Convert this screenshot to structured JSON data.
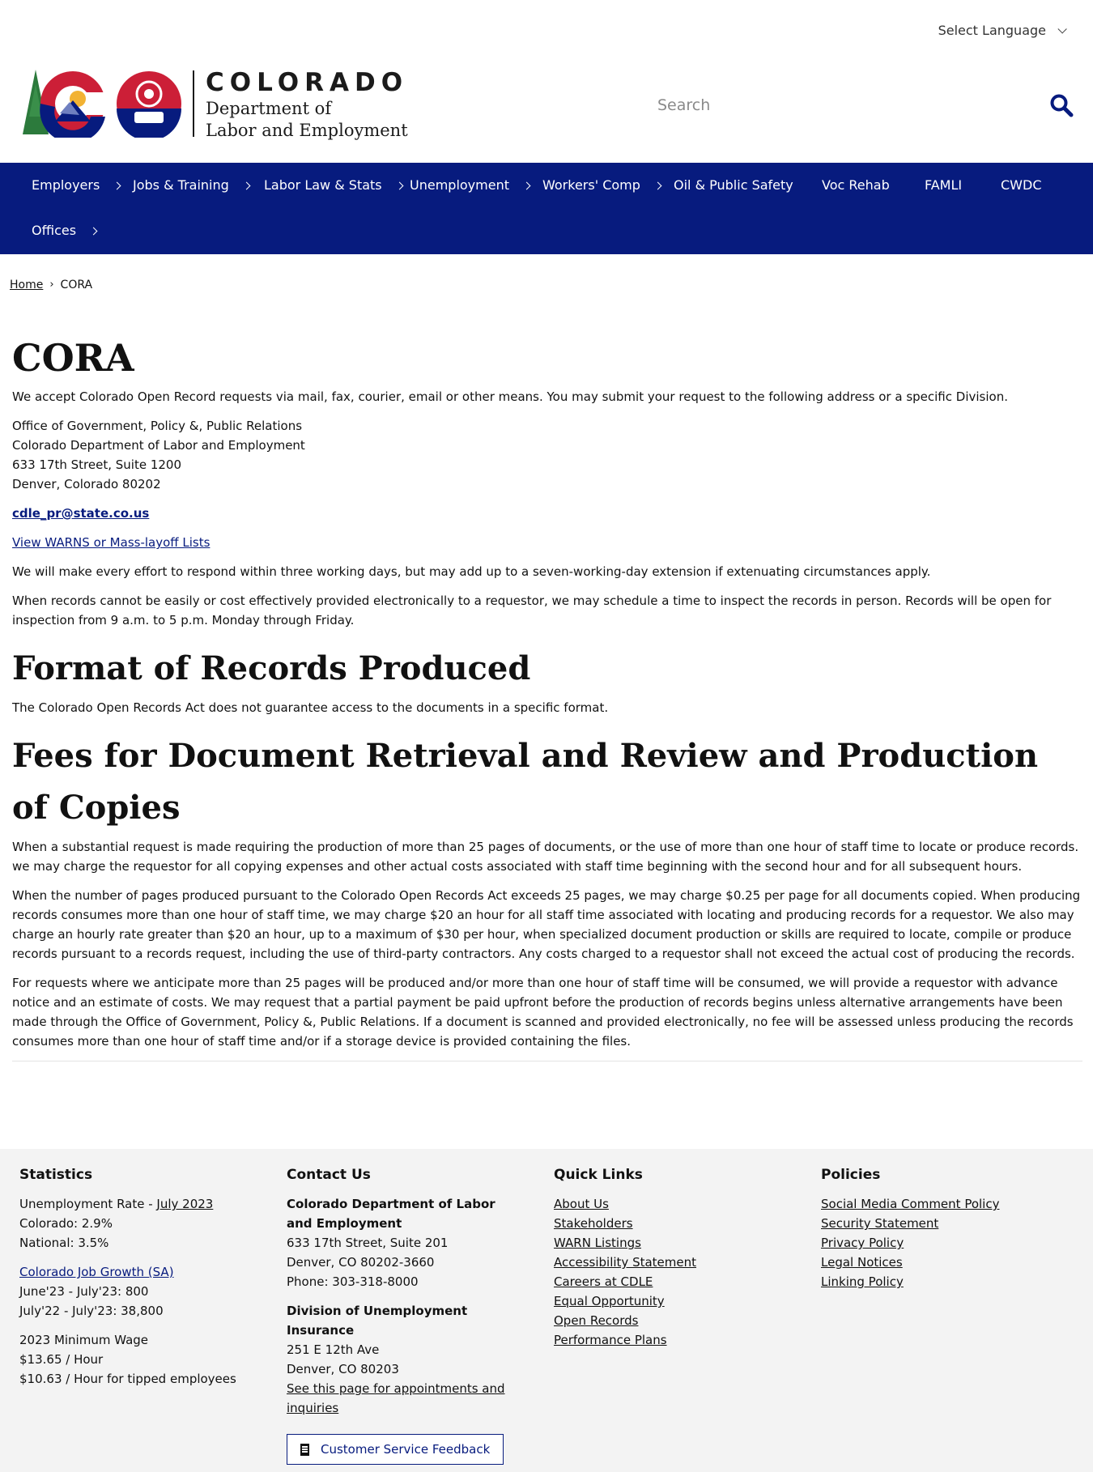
{
  "language": {
    "label": "Select Language"
  },
  "header": {
    "state": "COLORADO",
    "dept_line1": "Department of",
    "dept_line2": "Labor and Employment",
    "logo_badge": "CDLE",
    "search_placeholder": "Search"
  },
  "nav": {
    "items": [
      {
        "label": "Employers",
        "has_submenu": true
      },
      {
        "label": "Jobs & Training",
        "has_submenu": true
      },
      {
        "label": "Labor Law & Stats",
        "has_submenu": true
      },
      {
        "label": "Unemployment",
        "has_submenu": true
      },
      {
        "label": "Workers' Comp",
        "has_submenu": true
      },
      {
        "label": "Oil & Public Safety",
        "has_submenu": false
      },
      {
        "label": "Voc Rehab",
        "has_submenu": false
      },
      {
        "label": "FAMLI",
        "has_submenu": false
      },
      {
        "label": "CWDC",
        "has_submenu": false
      },
      {
        "label": "Offices",
        "has_submenu": true
      }
    ]
  },
  "breadcrumb": {
    "home": "Home",
    "current": "CORA"
  },
  "main": {
    "title": "CORA",
    "intro": "We accept Colorado Open Record requests via mail, fax, courier, email or other means. You may submit your request to the following address or a specific Division.",
    "address": [
      "Office of Government, Policy &, Public Relations",
      "Colorado Department of Labor and Employment",
      "633 17th Street, Suite 1200",
      "Denver, Colorado 80202"
    ],
    "email": "cdle_pr@state.co.us",
    "warns_link": "View WARNS or Mass-layoff Lists",
    "response_text": "We will make every effort to respond within three working days, but may add up to a seven-working-day extension if extenuating circumstances apply.",
    "inspection_text": "When records cannot be easily or cost effectively provided electronically to a requestor, we may schedule a time to inspect the records in person. Records will be open for inspection from 9 a.m. to 5 p.m. Monday through Friday.",
    "format_heading": "Format of Records Produced",
    "format_text": "The Colorado Open Records Act does not guarantee access to the documents in a specific format.",
    "fees_heading": "Fees for Document Retrieval and Review and Production of Copies",
    "fees_p1": "When a substantial request is made requiring the production of more than 25 pages of documents, or the use of more than one hour of staff time to locate or produce records. we may charge the requestor for all copying expenses and other actual costs associated with staff time beginning with the second hour and for all subsequent hours.",
    "fees_p2": "When the number of pages produced pursuant to the Colorado Open Records Act exceeds 25 pages, we may charge $0.25 per page for all documents copied. When producing records consumes more than one hour of staff time, we may charge $20 an hour for all staff time associated with locating and producing records for a requestor. We also may charge an hourly rate greater than $20 an hour, up to a maximum of $30 per hour, when specialized document production or skills are required to locate, compile or produce records pursuant to a records request, including the use of third-party contractors. Any costs charged to a requestor shall not exceed the actual cost of producing the records.",
    "fees_p3": "For requests where we anticipate more than 25 pages will be produced and/or more than one hour of staff time will be consumed, we will provide a requestor with advance notice and an estimate of costs. We may request that a partial payment be paid upfront before the production of records begins unless alternative arrangements have been made through the Office of Government, Policy &, Public Relations. If a document is scanned and provided electronically, no fee will be assessed unless producing the records consumes more than one hour of staff time and/or if a storage device is provided containing the files."
  },
  "footer": {
    "statistics": {
      "heading": "Statistics",
      "unemp_prefix": "Unemployment Rate - ",
      "unemp_link": "July 2023",
      "colorado": "Colorado: 2.9%",
      "national": "National: 3.5%",
      "job_growth_link": "Colorado Job Growth (SA)",
      "june_july": "June'23 - July'23: 800",
      "july_july": "July'22 - July'23: 38,800",
      "min_wage_title": "2023 Minimum Wage",
      "min_wage": "$13.65 / Hour",
      "tipped_wage": "$10.63 / Hour for tipped employees"
    },
    "contact": {
      "heading": "Contact Us",
      "org_name": "Colorado Department of Labor and Employment",
      "org_street": "633 17th Street, Suite 201",
      "org_city": "Denver, CO  80202-3660",
      "org_phone": "Phone: 303-318-8000",
      "ui_name": "Division of Unemployment Insurance",
      "ui_street": "251 E 12th Ave",
      "ui_city": "Denver, CO  80203",
      "ui_link": "See this page for appointments and inquiries",
      "feedback": "Customer Service Feedback"
    },
    "quick_links": {
      "heading": "Quick Links",
      "items": [
        "About Us",
        "Stakeholders",
        "WARN Listings",
        "Accessibility Statement",
        "Careers at CDLE",
        "Equal Opportunity",
        "Open Records",
        "Performance Plans"
      ]
    },
    "policies": {
      "heading": "Policies",
      "items": [
        "Social Media Comment Policy",
        "Security Statement",
        "Privacy Policy",
        "Legal Notices",
        "Linking Policy"
      ]
    }
  },
  "colors": {
    "nav_bg": "#071b7e",
    "brand_red": "#cc1f37",
    "brand_navy": "#071b7e",
    "logo_green": "#2c7a3c",
    "logo_gold": "#f2b233",
    "footer_bg": "#f3f3f3"
  }
}
